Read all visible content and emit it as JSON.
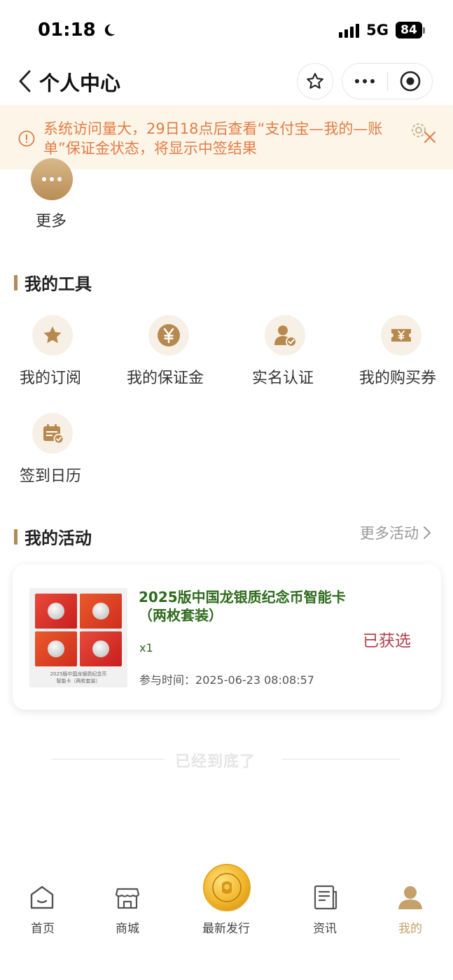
{
  "status_bar": {
    "time": "01:18",
    "network": "5G",
    "battery": "84"
  },
  "header": {
    "title": "个人中心"
  },
  "notice": {
    "text": "系统访问量大，29日18点后查看“支付宝—我的—账单”保证金状态，将显示中签结果"
  },
  "more_shortcut": {
    "label": "更多"
  },
  "tools_section": {
    "title": "我的工具",
    "items": [
      {
        "label": "我的订阅",
        "icon": "star-icon"
      },
      {
        "label": "我的保证金",
        "icon": "yen-coin-icon"
      },
      {
        "label": "实名认证",
        "icon": "verified-user-icon"
      },
      {
        "label": "我的购买券",
        "icon": "ticket-icon"
      },
      {
        "label": "签到日历",
        "icon": "calendar-check-icon"
      }
    ]
  },
  "activities_section": {
    "title": "我的活动",
    "more_label": "更多活动",
    "items": [
      {
        "title_line1": "2025版中国龙银质纪念币智能卡",
        "title_line2": "（两枚套装）",
        "quantity": "x1",
        "time_label": "参与时间：",
        "time_value": "2025-06-23 08:08:57",
        "status": "已获选",
        "thumb_caption_line1": "2025版中国龙银质纪念币",
        "thumb_caption_line2": "智能卡（两枚套装）"
      }
    ]
  },
  "end_text": "已经到底了",
  "tabbar": {
    "items": [
      {
        "label": "首页",
        "icon": "home-icon"
      },
      {
        "label": "商城",
        "icon": "store-icon"
      },
      {
        "label": "最新发行",
        "icon": "gold-coin-icon"
      },
      {
        "label": "资讯",
        "icon": "news-icon"
      },
      {
        "label": "我的",
        "icon": "profile-icon",
        "active": true
      }
    ]
  },
  "colors": {
    "accent_gold": "#b38a57",
    "notice_text": "#e27c46",
    "title_green": "#2e6b1d",
    "status_red": "#b3404a"
  }
}
